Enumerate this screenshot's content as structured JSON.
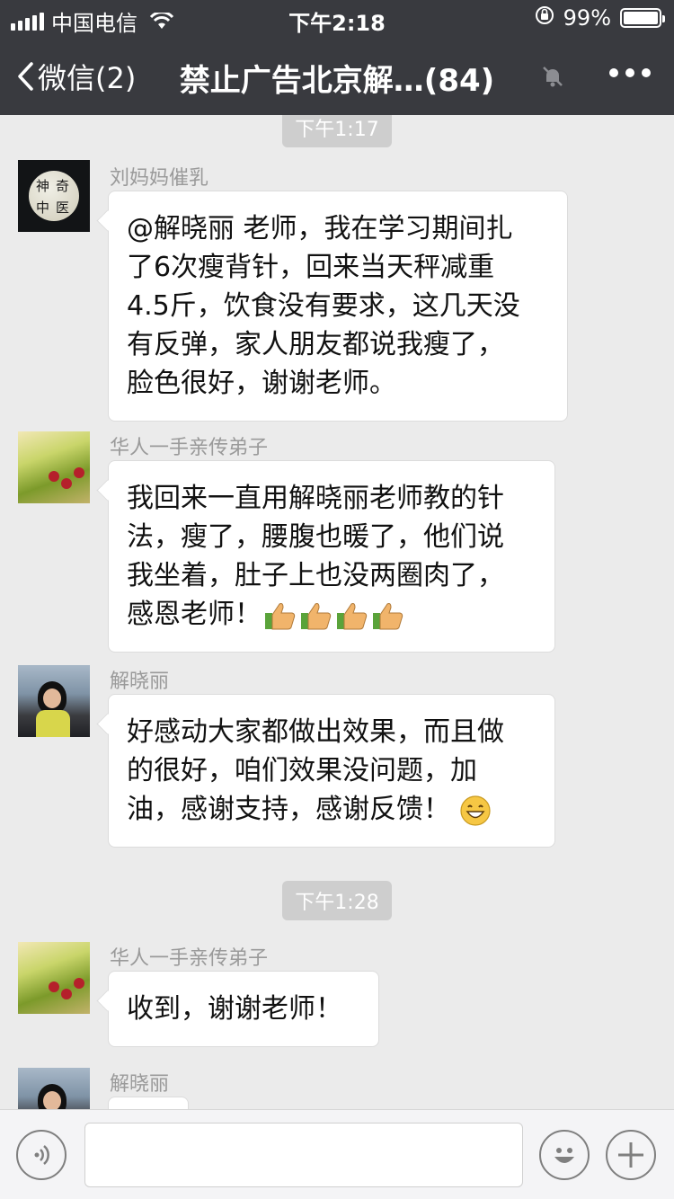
{
  "status_bar": {
    "carrier": "中国电信",
    "time": "下午2:18",
    "battery": "99%",
    "battery_level": 0.99
  },
  "nav": {
    "back_label": "微信(2)",
    "title": "禁止广告北京解…(84)"
  },
  "chat": {
    "timestamps": [
      "下午1:17",
      "下午1:28"
    ],
    "messages": [
      {
        "sender": "刘妈妈催乳",
        "text": "@解晓丽 老师，我在学习期间扎\n了6次瘦背针，回来当天秤减重\n4.5斤，饮食没有要求，这几天没\n有反弹，家人朋友都说我瘦了，\n脸色很好，谢谢老师。",
        "avatar_text": [
          "神",
          "奇",
          "中",
          "医"
        ]
      },
      {
        "sender": "华人一手亲传弟子",
        "text": "我回来一直用解晓丽老师教的针\n法，瘦了，腰腹也暖了，他们说\n我坐着，肚子上也没两圈肉了，\n感恩老师！",
        "emoji": "thumbs-up x4"
      },
      {
        "sender": "解晓丽",
        "text": "好感动大家都做出效果，而且做\n的很好，咱们效果没问题，加\n油，感谢支持，感谢反馈！",
        "emoji": "grin"
      },
      {
        "sender": "华人一手亲传弟子",
        "text": "收到，谢谢老师！"
      },
      {
        "sender": "解晓丽",
        "text": ""
      }
    ]
  },
  "input_bar": {
    "voice_icon": "voice-icon",
    "emoji_icon": "emoji-icon",
    "plus_icon": "plus-icon"
  },
  "colors": {
    "header_bg": "#393a3f",
    "chat_bg": "#ebebeb",
    "bubble_bg": "#ffffff",
    "timestamp_bg": "#cecece"
  }
}
